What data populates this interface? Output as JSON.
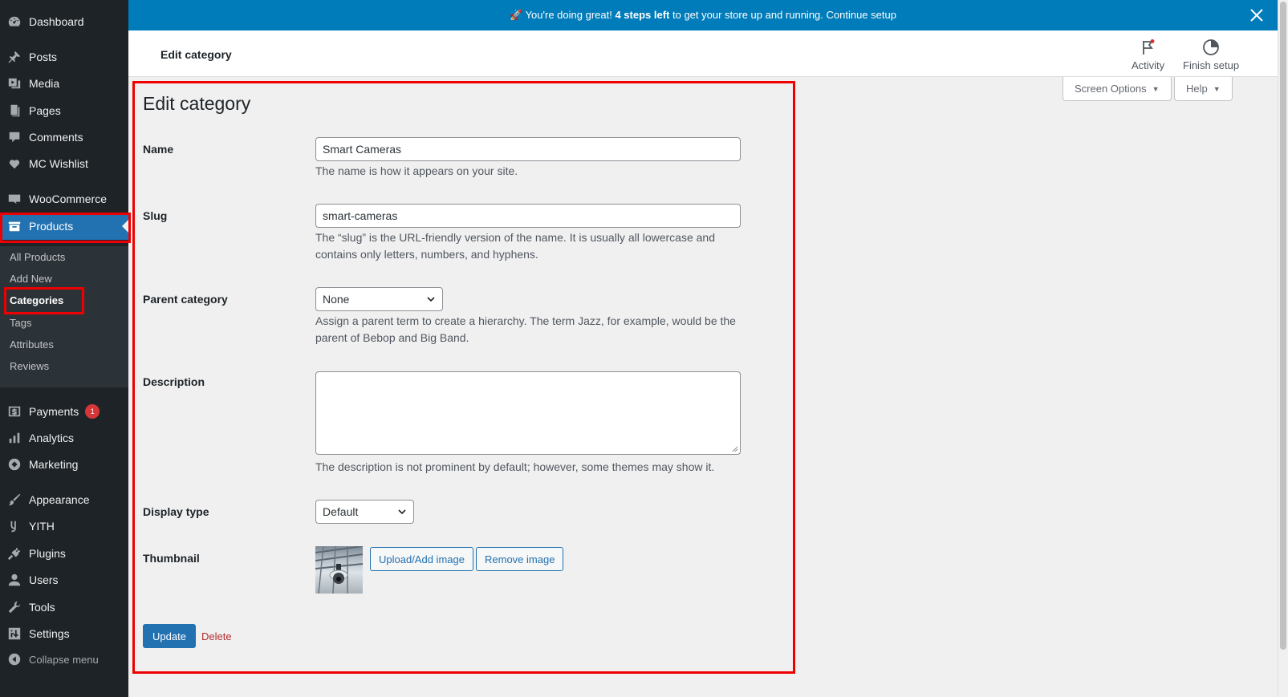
{
  "sidebar": {
    "items": [
      {
        "label": "Dashboard",
        "icon": "dashboard-icon"
      },
      {
        "label": "Posts",
        "icon": "pushpin-icon"
      },
      {
        "label": "Media",
        "icon": "media-icon"
      },
      {
        "label": "Pages",
        "icon": "pages-icon"
      },
      {
        "label": "Comments",
        "icon": "comment-icon"
      },
      {
        "label": "MC Wishlist",
        "icon": "heart-icon"
      },
      {
        "label": "WooCommerce",
        "icon": "woo-icon"
      },
      {
        "label": "Products",
        "icon": "archive-icon"
      },
      {
        "label": "Payments",
        "icon": "dollar-icon",
        "badge": "1"
      },
      {
        "label": "Analytics",
        "icon": "bar-chart-icon"
      },
      {
        "label": "Marketing",
        "icon": "megaphone-icon"
      },
      {
        "label": "Appearance",
        "icon": "paintbrush-icon"
      },
      {
        "label": "YITH",
        "icon": "yith-icon"
      },
      {
        "label": "Plugins",
        "icon": "plugin-icon"
      },
      {
        "label": "Users",
        "icon": "user-icon"
      },
      {
        "label": "Tools",
        "icon": "wrench-icon"
      },
      {
        "label": "Settings",
        "icon": "settings-icon"
      },
      {
        "label": "Collapse menu",
        "icon": "collapse-icon"
      }
    ],
    "submenu": [
      "All Products",
      "Add New",
      "Categories",
      "Tags",
      "Attributes",
      "Reviews"
    ]
  },
  "notice": {
    "prefix": "🚀 You're doing great! ",
    "bold": "4 steps left",
    "suffix": " to get your store up and running. Continue setup"
  },
  "header": {
    "title": "Edit category",
    "activity_label": "Activity",
    "finish_label": "Finish setup"
  },
  "screen_options": {
    "label": "Screen Options",
    "help_label": "Help"
  },
  "form": {
    "page_title": "Edit category",
    "name_label": "Name",
    "name_value": "Smart Cameras",
    "name_help": "The name is how it appears on your site.",
    "slug_label": "Slug",
    "slug_value": "smart-cameras",
    "slug_help": "The “slug” is the URL-friendly version of the name. It is usually all lowercase and contains only letters, numbers, and hyphens.",
    "parent_label": "Parent category",
    "parent_value": "None",
    "parent_help": "Assign a parent term to create a hierarchy. The term Jazz, for example, would be the parent of Bebop and Big Band.",
    "description_label": "Description",
    "description_value": "",
    "description_help": "The description is not prominent by default; however, some themes may show it.",
    "display_label": "Display type",
    "display_value": "Default",
    "thumbnail_label": "Thumbnail",
    "upload_label": "Upload/Add image",
    "remove_label": "Remove image",
    "update_label": "Update",
    "delete_label": "Delete"
  },
  "colors": {
    "accent": "#2271b1",
    "notice": "#007cba",
    "sidebar": "#1d2327",
    "highlight": "#ee0000",
    "delete": "#b32d2e"
  }
}
